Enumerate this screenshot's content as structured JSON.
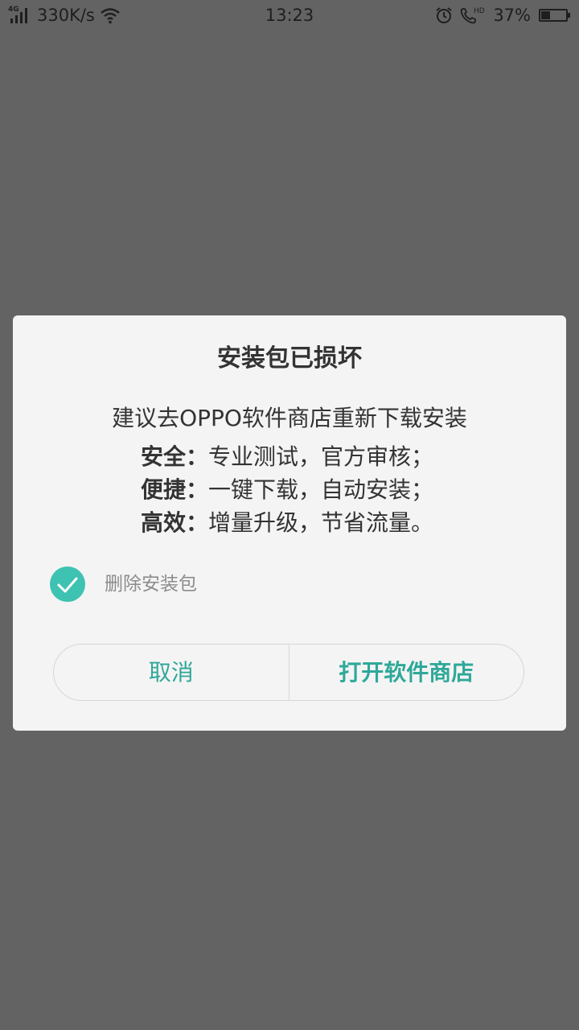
{
  "status_bar": {
    "network_type": "4G",
    "net_speed": "330K/s",
    "time": "13:23",
    "call_badge": "HD",
    "battery_percent": "37%",
    "battery_level": 0.37,
    "icons": [
      "signal-icon",
      "wifi-icon",
      "alarm-icon",
      "hd-call-icon",
      "battery-icon"
    ]
  },
  "dialog": {
    "title": "安装包已损坏",
    "message": "建议去OPPO软件商店重新下载安装",
    "features": [
      {
        "key": "安全：",
        "value": "专业测试，官方审核；"
      },
      {
        "key": "便捷：",
        "value": "一键下载，自动安装；"
      },
      {
        "key": "高效：",
        "value": "增量升级，节省流量。"
      }
    ],
    "checkbox": {
      "label": "删除安装包",
      "checked": true
    },
    "cancel_label": "取消",
    "confirm_label": "打开软件商店"
  },
  "colors": {
    "overlay": "#636363",
    "dialog_bg": "#f4f4f4",
    "accent": "#2fa899",
    "check_bg": "#3ec2b2"
  }
}
